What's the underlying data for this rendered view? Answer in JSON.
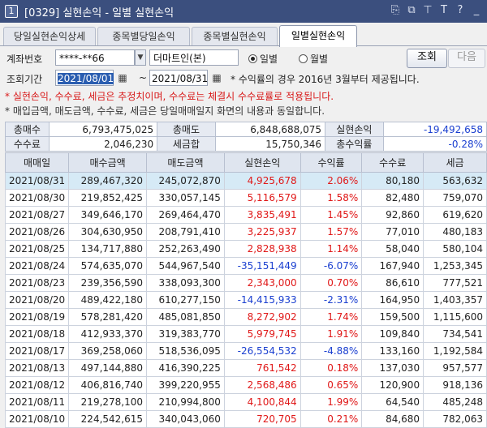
{
  "window": {
    "number": "1",
    "title": "[0329] 실현손익 - 일별 실현손익",
    "icons": [
      "link-icon",
      "copy-icon",
      "pin-icon",
      "text-size-icon",
      "help-icon",
      "minimize-icon"
    ]
  },
  "tabs": [
    {
      "label": "당일실현손익상세",
      "active": false
    },
    {
      "label": "종목별당일손익",
      "active": false
    },
    {
      "label": "종목별실현손익",
      "active": false
    },
    {
      "label": "일별실현손익",
      "active": true
    }
  ],
  "account": {
    "label": "계좌번호",
    "number": "****-**66",
    "owner": "더마트인(본)"
  },
  "period_mode": {
    "daily": "일별",
    "monthly": "월별",
    "selected": "daily"
  },
  "buttons": {
    "search": "조회",
    "next": "다음"
  },
  "period": {
    "label": "조회기간",
    "start": "2021/08/01",
    "tilde": "~",
    "end": "2021/08/31",
    "note": "* 수익률의 경우 2016년 3월부터 제공됩니다."
  },
  "notices": {
    "red": "* 실현손익, 수수료, 세금은 추정치이며, 수수료는 체결시 수수료률로 적용됩니다.",
    "gray": "* 매입금액, 매도금액, 수수료, 세금은 당일매매일지 화면의 내용과 동일합니다."
  },
  "summary": {
    "r1": [
      {
        "label": "총매수",
        "value": "6,793,475,025"
      },
      {
        "label": "총매도",
        "value": "6,848,688,075"
      },
      {
        "label": "실현손익",
        "value": "-19,492,658"
      }
    ],
    "r2": [
      {
        "label": "수수료",
        "value": "2,046,230"
      },
      {
        "label": "세금합",
        "value": "15,750,346"
      },
      {
        "label": "총수익률",
        "value": "-0.28%"
      }
    ]
  },
  "grid": {
    "headers": [
      "매매일",
      "매수금액",
      "매도금액",
      "실현손익",
      "수익률",
      "수수료",
      "세금"
    ],
    "rows": [
      [
        "2021/08/31",
        "289,467,320",
        "245,072,870",
        "4,925,678",
        "2.06%",
        "80,180",
        "563,632"
      ],
      [
        "2021/08/30",
        "219,852,425",
        "330,057,145",
        "5,116,579",
        "1.58%",
        "82,480",
        "759,070"
      ],
      [
        "2021/08/27",
        "349,646,170",
        "269,464,470",
        "3,835,491",
        "1.45%",
        "92,860",
        "619,620"
      ],
      [
        "2021/08/26",
        "304,630,950",
        "208,791,410",
        "3,225,937",
        "1.57%",
        "77,010",
        "480,183"
      ],
      [
        "2021/08/25",
        "134,717,880",
        "252,263,490",
        "2,828,938",
        "1.14%",
        "58,040",
        "580,104"
      ],
      [
        "2021/08/24",
        "574,635,070",
        "544,967,540",
        "-35,151,449",
        "-6.07%",
        "167,940",
        "1,253,345"
      ],
      [
        "2021/08/23",
        "239,356,590",
        "338,093,300",
        "2,343,000",
        "0.70%",
        "86,610",
        "777,521"
      ],
      [
        "2021/08/20",
        "489,422,180",
        "610,277,150",
        "-14,415,933",
        "-2.31%",
        "164,950",
        "1,403,357"
      ],
      [
        "2021/08/19",
        "578,281,420",
        "485,081,850",
        "8,272,902",
        "1.74%",
        "159,500",
        "1,115,600"
      ],
      [
        "2021/08/18",
        "412,933,370",
        "319,383,770",
        "5,979,745",
        "1.91%",
        "109,840",
        "734,541"
      ],
      [
        "2021/08/17",
        "369,258,060",
        "518,536,095",
        "-26,554,532",
        "-4.88%",
        "133,160",
        "1,192,584"
      ],
      [
        "2021/08/13",
        "497,144,880",
        "416,390,225",
        "761,542",
        "0.18%",
        "137,030",
        "957,577"
      ],
      [
        "2021/08/12",
        "406,816,740",
        "399,220,955",
        "2,568,486",
        "0.65%",
        "120,900",
        "918,136"
      ],
      [
        "2021/08/11",
        "219,278,100",
        "210,994,800",
        "4,100,844",
        "1.99%",
        "64,540",
        "485,248"
      ],
      [
        "2021/08/10",
        "224,542,615",
        "340,043,060",
        "720,705",
        "0.21%",
        "84,680",
        "782,063"
      ]
    ]
  },
  "colors": {
    "positive": "#e01818",
    "negative": "#1a3fd0",
    "selected_row": "#d6eaf6",
    "titlebar": "#3b4f7e"
  }
}
